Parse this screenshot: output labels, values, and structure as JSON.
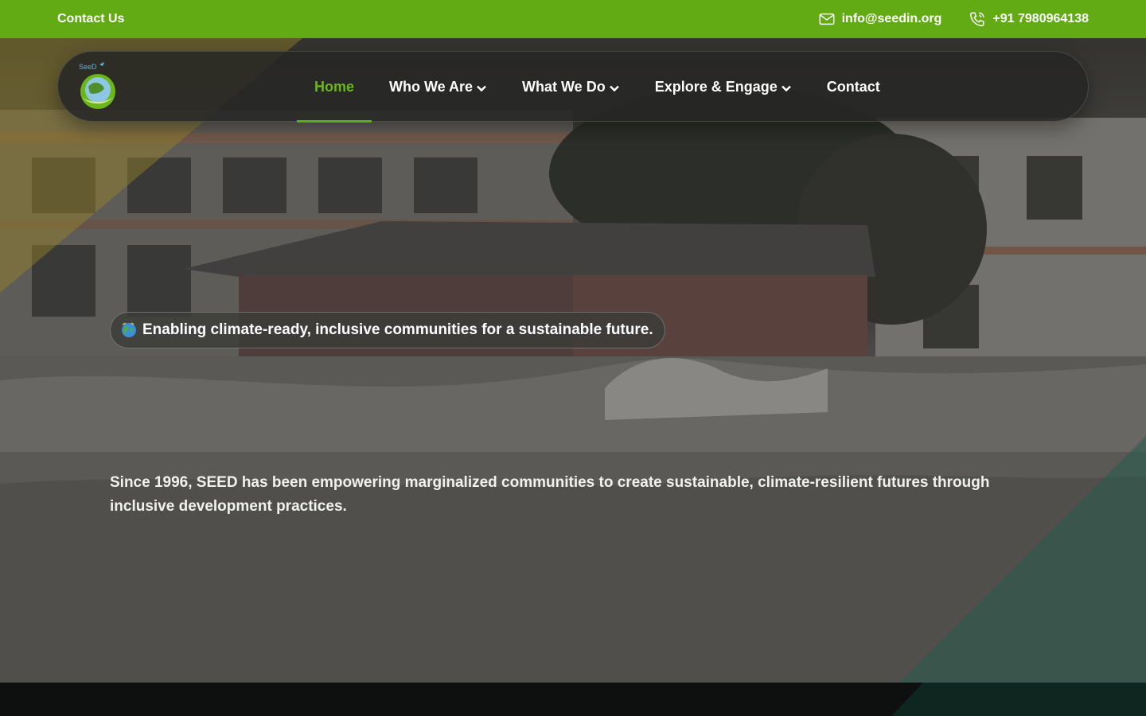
{
  "topbar": {
    "contact_label": "Contact Us",
    "email": "info@seedin.org",
    "phone": "+91 7980964138",
    "icons": [
      "mail-icon",
      "phone-icon"
    ],
    "background_color": "#62ab14"
  },
  "nav": {
    "logo_icon": "seed-logo",
    "items": [
      {
        "label": "Home",
        "active": true,
        "has_dropdown": false
      },
      {
        "label": "Who We Are",
        "active": false,
        "has_dropdown": true
      },
      {
        "label": "What We Do",
        "active": false,
        "has_dropdown": true
      },
      {
        "label": "Explore & Engage",
        "active": false,
        "has_dropdown": true
      },
      {
        "label": "Contact",
        "active": false,
        "has_dropdown": false
      }
    ],
    "active_color": "#6ab71a"
  },
  "hero": {
    "tagline": "Enabling climate-ready, inclusive communities for a sustainable future.",
    "tagline_icon": "globe-icon",
    "intro": "Since 1996, SEED has been empowering marginalized communities to create sustainable, climate-resilient futures through inclusive development practices."
  }
}
